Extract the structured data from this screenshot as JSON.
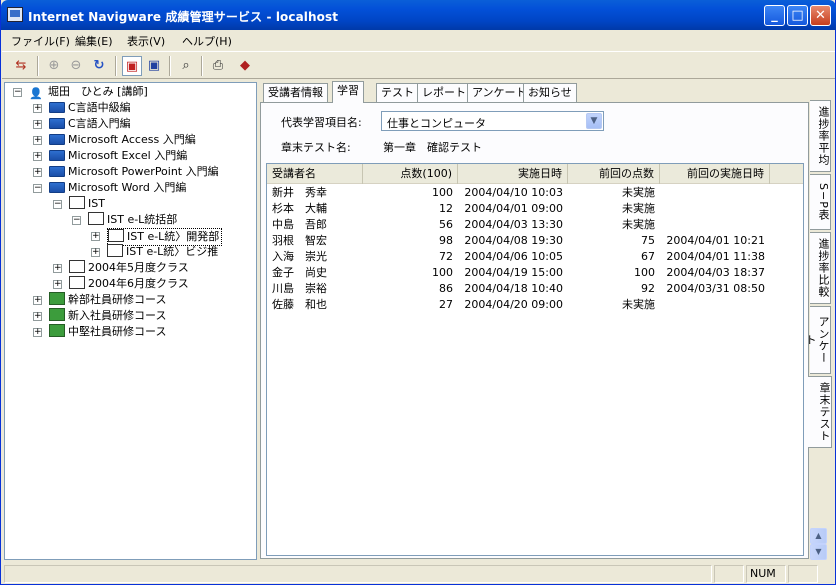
{
  "window": {
    "title": "Internet Navigware 成績管理サービス - localhost",
    "min": "_",
    "max": "□",
    "close": "✕"
  },
  "menu": [
    "ファイル(F)",
    "編集(E)",
    "表示(V)",
    "ヘルプ(H)"
  ],
  "toolbar_icons": [
    "exit-icon",
    "zoom-in-icon",
    "zoom-out-icon",
    "refresh-icon",
    "view-mode-1-icon",
    "view-mode-2-icon",
    "user-search-icon",
    "print-icon",
    "book-icon"
  ],
  "tree": {
    "root": "堀田　ひとみ [講師]",
    "nodes": [
      {
        "label": "C言語中級編",
        "exp": "+"
      },
      {
        "label": "C言語入門編",
        "exp": "+"
      },
      {
        "label": "Microsoft Access 入門編",
        "exp": "+"
      },
      {
        "label": "Microsoft Excel 入門編",
        "exp": "+"
      },
      {
        "label": "Microsoft PowerPoint 入門編",
        "exp": "+"
      },
      {
        "label": "Microsoft Word 入門編",
        "exp": "−"
      },
      {
        "label": "IST",
        "exp": "−"
      },
      {
        "label": "IST e-L統括部",
        "exp": "−"
      },
      {
        "label": "IST e-L統〉開発部",
        "exp": "+"
      },
      {
        "label": "IST e-L統〉ビジ推",
        "exp": "+"
      },
      {
        "label": "2004年5月度クラス",
        "exp": "+"
      },
      {
        "label": "2004年6月度クラス",
        "exp": "+"
      },
      {
        "label": "幹部社員研修コース",
        "exp": "+"
      },
      {
        "label": "新入社員研修コース",
        "exp": "+"
      },
      {
        "label": "中堅社員研修コース",
        "exp": "+"
      }
    ]
  },
  "tabs": [
    "受講者情報",
    "学習",
    "テスト",
    "レポート",
    "アンケート",
    "お知らせ"
  ],
  "form": {
    "item_label": "代表学習項目名:",
    "item_value": "仕事とコンピュータ",
    "test_label": "章末テスト名:",
    "test_value": "第一章　確認テスト"
  },
  "table": {
    "headers": [
      "受講者名",
      "点数(100)",
      "実施日時",
      "前回の点数",
      "前回の実施日時"
    ],
    "rows": [
      [
        "新井　秀幸",
        "100",
        "2004/04/10 10:03",
        "未実施",
        ""
      ],
      [
        "杉本　大輔",
        "12",
        "2004/04/01 09:00",
        "未実施",
        ""
      ],
      [
        "中島　吾郎",
        "56",
        "2004/04/03 13:30",
        "未実施",
        ""
      ],
      [
        "羽根　智宏",
        "98",
        "2004/04/08 19:30",
        "75",
        "2004/04/01 10:21"
      ],
      [
        "入海　崇光",
        "72",
        "2004/04/06 10:05",
        "67",
        "2004/04/01 11:38"
      ],
      [
        "金子　尚史",
        "100",
        "2004/04/19 15:00",
        "100",
        "2004/04/03 18:37"
      ],
      [
        "川島　崇裕",
        "86",
        "2004/04/18 10:40",
        "92",
        "2004/03/31 08:50"
      ],
      [
        "佐藤　和也",
        "27",
        "2004/04/20 09:00",
        "未実施",
        ""
      ]
    ]
  },
  "vtabs": [
    "進捗率平均",
    "S−P表",
    "進捗率比較",
    "アンケート",
    "章末テスト"
  ],
  "status": {
    "num": "NUM"
  }
}
